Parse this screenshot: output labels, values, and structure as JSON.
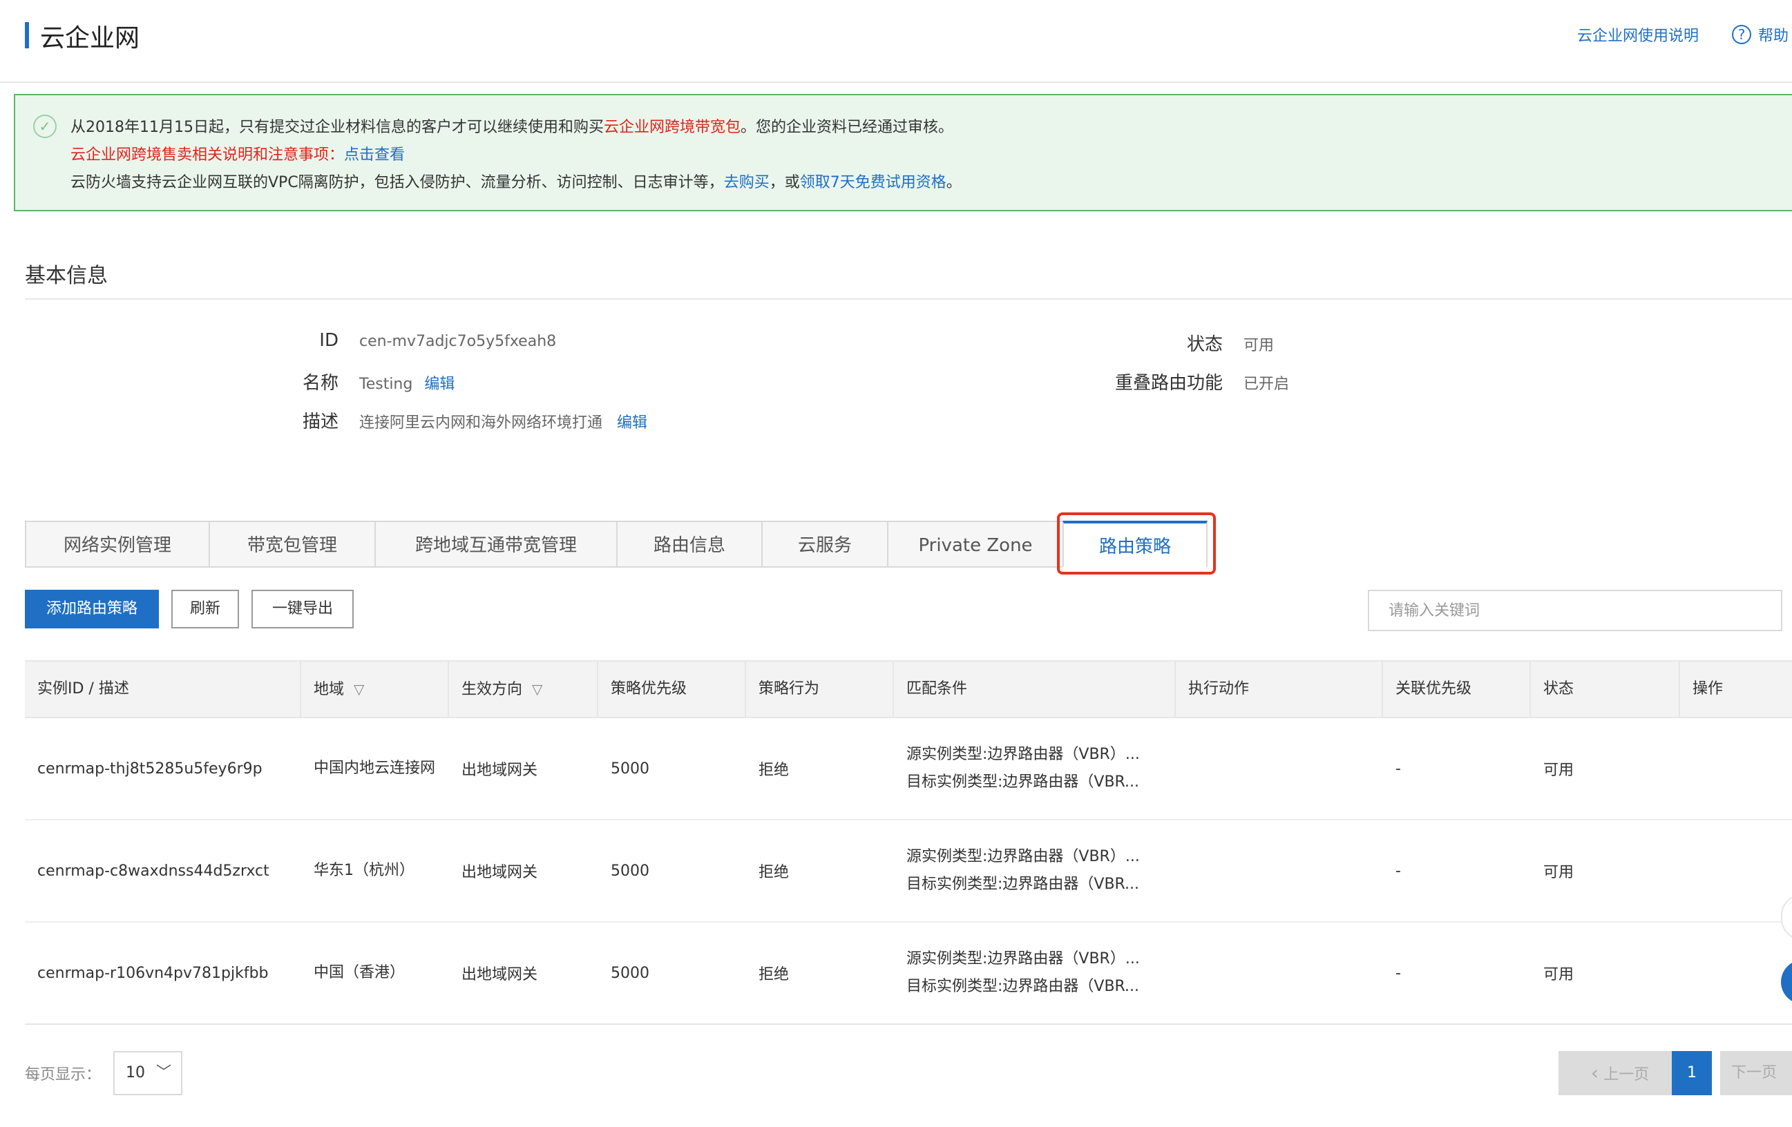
{
  "header": {
    "title": "云企业网",
    "usage_link": "云企业网使用说明",
    "help_link": "帮助"
  },
  "notice": {
    "line1_a": "从2018年11月15日起，只有提交过企业材料信息的客户才可以继续使用和购买",
    "line1_b": "云企业网跨境带宽包",
    "line1_c": "。您的企业资料已经通过审核。",
    "line2_a": "云企业网跨境售卖相关说明和注意事项：",
    "line2_b": "点击查看",
    "line3_a": "云防火墙支持云企业网互联的VPC隔离防护，包括入侵防护、流量分析、访问控制、日志审计等，",
    "line3_b": "去购买",
    "line3_c": "，或",
    "line3_d": "领取7天免费试用资格",
    "line3_e": "。"
  },
  "basic": {
    "title": "基本信息",
    "id_label": "ID",
    "id_value": "cen-mv7adjc7o5y5fxeah8",
    "name_label": "名称",
    "name_value": "Testing",
    "edit": "编辑",
    "desc_label": "描述",
    "desc_value": "连接阿里云内网和海外网络环境打通",
    "status_label": "状态",
    "status_value": "可用",
    "overlap_label": "重叠路由功能",
    "overlap_value": "已开启"
  },
  "tabs": [
    "网络实例管理",
    "带宽包管理",
    "跨地域互通带宽管理",
    "路由信息",
    "云服务",
    "Private Zone",
    "路由策略"
  ],
  "toolbar": {
    "add": "添加路由策略",
    "refresh": "刷新",
    "export": "一键导出",
    "search_placeholder": "请输入关键词"
  },
  "table": {
    "headers": [
      "实例ID / 描述",
      "地域",
      "生效方向",
      "策略优先级",
      "策略行为",
      "匹配条件",
      "执行动作",
      "关联优先级",
      "状态",
      "操作"
    ],
    "rows": [
      {
        "id": "cenrmap-thj8t5285u5fey6r9p",
        "region": "中国内地云连接网",
        "direction": "出地域网关",
        "priority": "5000",
        "action": "拒绝",
        "cond1": "源实例类型:边界路由器（VBR）...",
        "cond2": "目标实例类型:边界路由器（VBR...",
        "exec": "",
        "rel": "-",
        "status": "可用",
        "op": ""
      },
      {
        "id": "cenrmap-c8waxdnss44d5zrxct",
        "region": "华东1（杭州）",
        "direction": "出地域网关",
        "priority": "5000",
        "action": "拒绝",
        "cond1": "源实例类型:边界路由器（VBR）...",
        "cond2": "目标实例类型:边界路由器（VBR...",
        "exec": "",
        "rel": "-",
        "status": "可用",
        "op": ""
      },
      {
        "id": "cenrmap-r106vn4pv781pjkfbb",
        "region": "中国（香港）",
        "direction": "出地域网关",
        "priority": "5000",
        "action": "拒绝",
        "cond1": "源实例类型:边界路由器（VBR）...",
        "cond2": "目标实例类型:边界路由器（VBR...",
        "exec": "",
        "rel": "-",
        "status": "可用",
        "op": ""
      }
    ]
  },
  "pagination": {
    "page_size_label": "每页显示：",
    "page_size": "10",
    "prev": "上一页",
    "current": "1",
    "next": "下一页"
  },
  "colors": {
    "accent": "#1f6fc5",
    "danger": "#e2231a",
    "success": "#3aaa35",
    "notice_bg": "#eaf5ec"
  },
  "icons": {
    "help": "help-circle-icon",
    "notice": "check-circle-icon",
    "filter": "filter-icon",
    "chevron": "chevron-down-icon",
    "prev": "chevron-left-icon"
  }
}
